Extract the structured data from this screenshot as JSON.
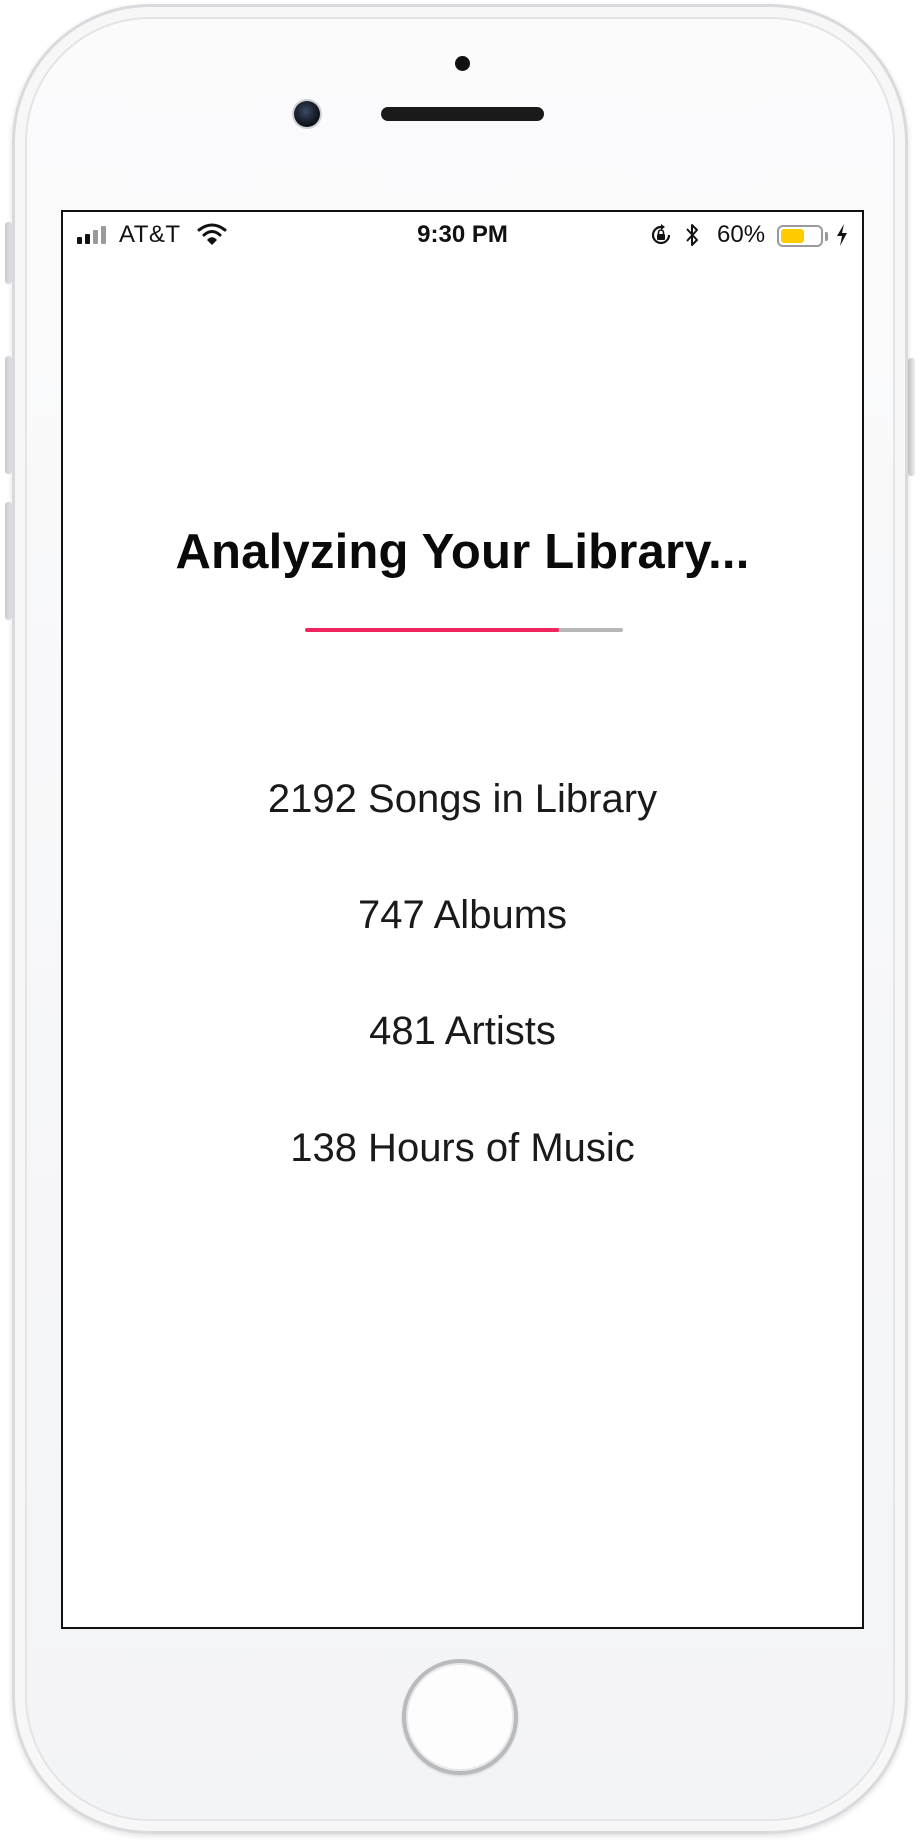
{
  "status_bar": {
    "carrier": "AT&T",
    "time": "9:30 PM",
    "battery_percent_label": "60%",
    "battery_level": 0.6,
    "battery_color": "#ffcc00",
    "signal_bars_active": 2,
    "signal_bars_total": 4,
    "icons": [
      "signal-icon",
      "wifi-icon",
      "rotation-lock-icon",
      "bluetooth-icon",
      "battery-icon",
      "charging-icon"
    ]
  },
  "main": {
    "title": "Analyzing Your Library...",
    "progress": 0.8,
    "progress_color": "#f0245f",
    "stats": [
      {
        "text": "2192 Songs in Library"
      },
      {
        "text": "747 Albums"
      },
      {
        "text": "481 Artists"
      },
      {
        "text": "138 Hours of Music"
      }
    ]
  },
  "device": {
    "home_button": "home-button"
  }
}
